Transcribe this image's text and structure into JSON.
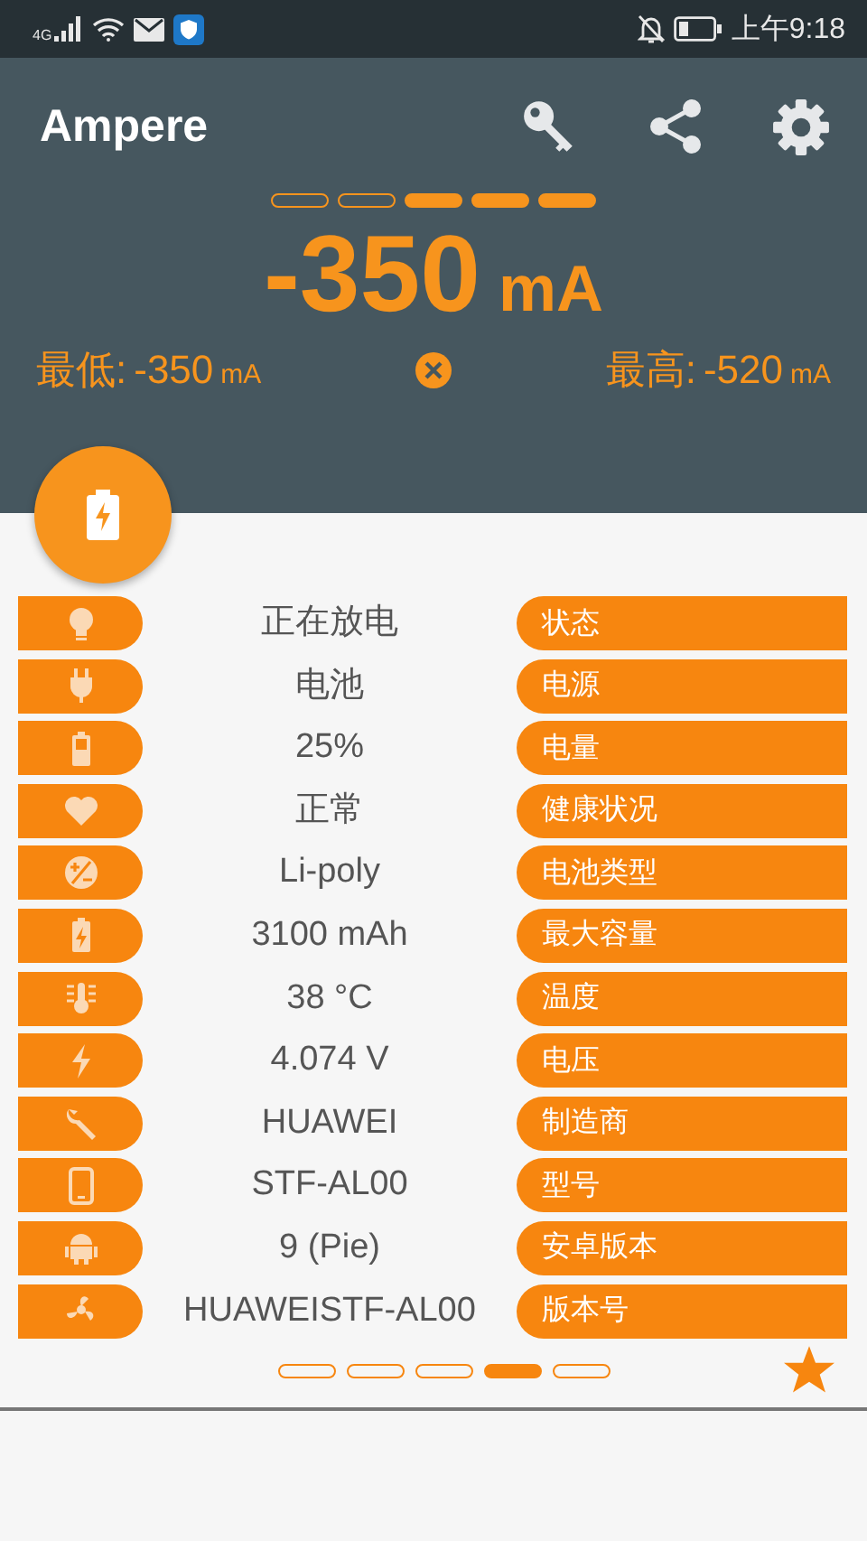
{
  "status_bar": {
    "network": "4G",
    "time": "上午9:18"
  },
  "app_bar": {
    "title": "Ampere"
  },
  "current": {
    "meter": {
      "level": 0.6
    },
    "value": "-350",
    "unit": "mA",
    "min": {
      "label": "最低:",
      "value": "-350",
      "unit": "mA"
    },
    "max": {
      "label": "最高:",
      "value": "-520",
      "unit": "mA"
    }
  },
  "rows": [
    {
      "value": "正在放电",
      "label": "状态"
    },
    {
      "value": "电池",
      "label": "电源"
    },
    {
      "value": "25%",
      "label": "电量"
    },
    {
      "value": "正常",
      "label": "健康状况"
    },
    {
      "value": "Li-poly",
      "label": "电池类型"
    },
    {
      "value": "3100 mAh",
      "label": "最大容量"
    },
    {
      "value": "38 °C",
      "label": "温度"
    },
    {
      "value": "4.074 V",
      "label": "电压"
    },
    {
      "value": "HUAWEI",
      "label": "制造商"
    },
    {
      "value": "STF-AL00",
      "label": "型号"
    },
    {
      "value": "9 (Pie)",
      "label": "安卓版本"
    },
    {
      "value": "HUAWEISTF-AL00",
      "label": "版本号"
    }
  ],
  "pager": [
    {
      "selected": false
    },
    {
      "selected": false
    },
    {
      "selected": false
    },
    {
      "selected": true
    },
    {
      "selected": false
    }
  ]
}
